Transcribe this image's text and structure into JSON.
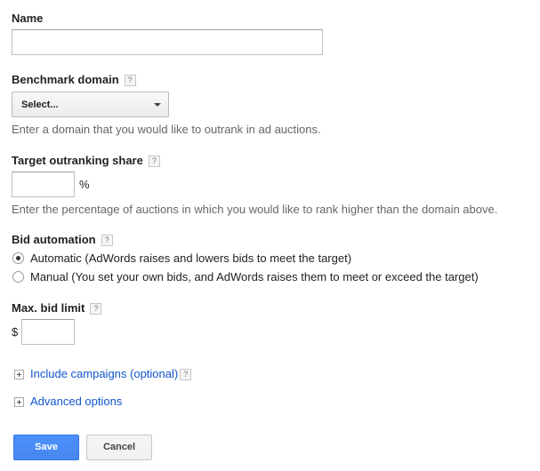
{
  "name": {
    "label": "Name",
    "value": ""
  },
  "benchmark": {
    "label": "Benchmark domain",
    "help": "?",
    "selected": "Select...",
    "hint": "Enter a domain that you would like to outrank in ad auctions."
  },
  "target": {
    "label": "Target outranking share",
    "help": "?",
    "value": "",
    "unit": "%",
    "hint": "Enter the percentage of auctions in which you would like to rank higher than the domain above."
  },
  "bid_automation": {
    "label": "Bid automation",
    "help": "?",
    "options": [
      {
        "label": "Automatic (AdWords raises and lowers bids to meet the target)",
        "checked": true
      },
      {
        "label": "Manual (You set your own bids, and AdWords raises them to meet or exceed the target)",
        "checked": false
      }
    ]
  },
  "max_bid": {
    "label": "Max. bid limit",
    "help": "?",
    "currency": "$",
    "value": ""
  },
  "include_campaigns": {
    "label": "Include campaigns (optional)",
    "help": "?"
  },
  "advanced_options": {
    "label": "Advanced options"
  },
  "buttons": {
    "save": "Save",
    "cancel": "Cancel"
  },
  "colors": {
    "link": "#1155cc",
    "primary": "#4d90fe",
    "hint": "#666666"
  },
  "icons": {
    "help": "help-icon",
    "expand": "plus-box-icon",
    "dropdown": "chevron-down-icon"
  }
}
